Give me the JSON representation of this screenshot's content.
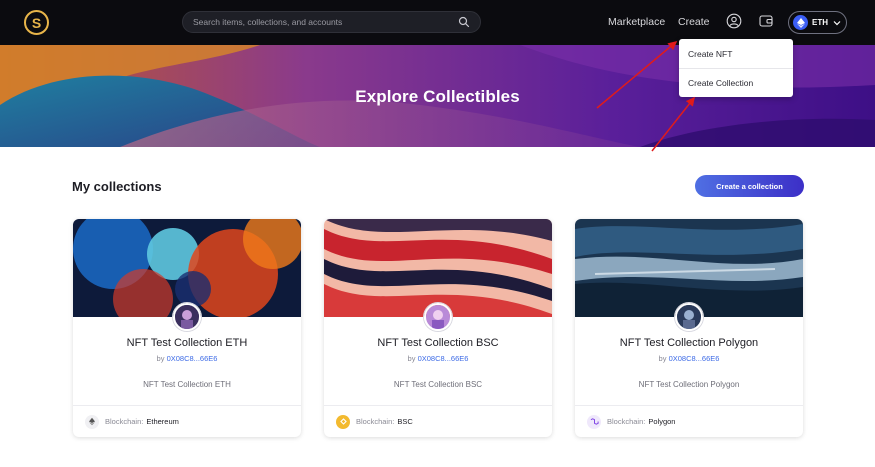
{
  "header": {
    "logo_letter": "S",
    "search_placeholder": "Search items, collections, and accounts",
    "nav": {
      "marketplace": "Marketplace",
      "create": "Create"
    },
    "chain_selector": {
      "label": "ETH",
      "icon": "ethereum-icon"
    },
    "icons": [
      "search-icon",
      "user-icon",
      "wallet-icon",
      "chevron-down-icon"
    ]
  },
  "create_menu": {
    "items": [
      "Create NFT",
      "Create Collection"
    ]
  },
  "hero": {
    "title": "Explore Collectibles"
  },
  "collections": {
    "title": "My collections",
    "create_button": "Create a collection",
    "by_prefix": "by",
    "blockchain_label": "Blockchain:",
    "cards": [
      {
        "name": "NFT Test Collection ETH",
        "owner": "0X08C8...66E6",
        "description": "NFT Test Collection ETH",
        "blockchain": "Ethereum",
        "chain_icon": "ethereum-icon"
      },
      {
        "name": "NFT Test Collection BSC",
        "owner": "0X08C8...66E6",
        "description": "NFT Test Collection BSC",
        "blockchain": "BSC",
        "chain_icon": "bsc-icon"
      },
      {
        "name": "NFT Test Collection Polygon",
        "owner": "0X08C8...66E6",
        "description": "NFT Test Collection Polygon",
        "blockchain": "Polygon",
        "chain_icon": "polygon-icon"
      }
    ]
  },
  "colors": {
    "header_bg": "#0b0b0f",
    "accent": "#3c2fc7",
    "link": "#3d6be6",
    "logo_gold": "#e8b54a",
    "annotation": "#e01b1b"
  }
}
